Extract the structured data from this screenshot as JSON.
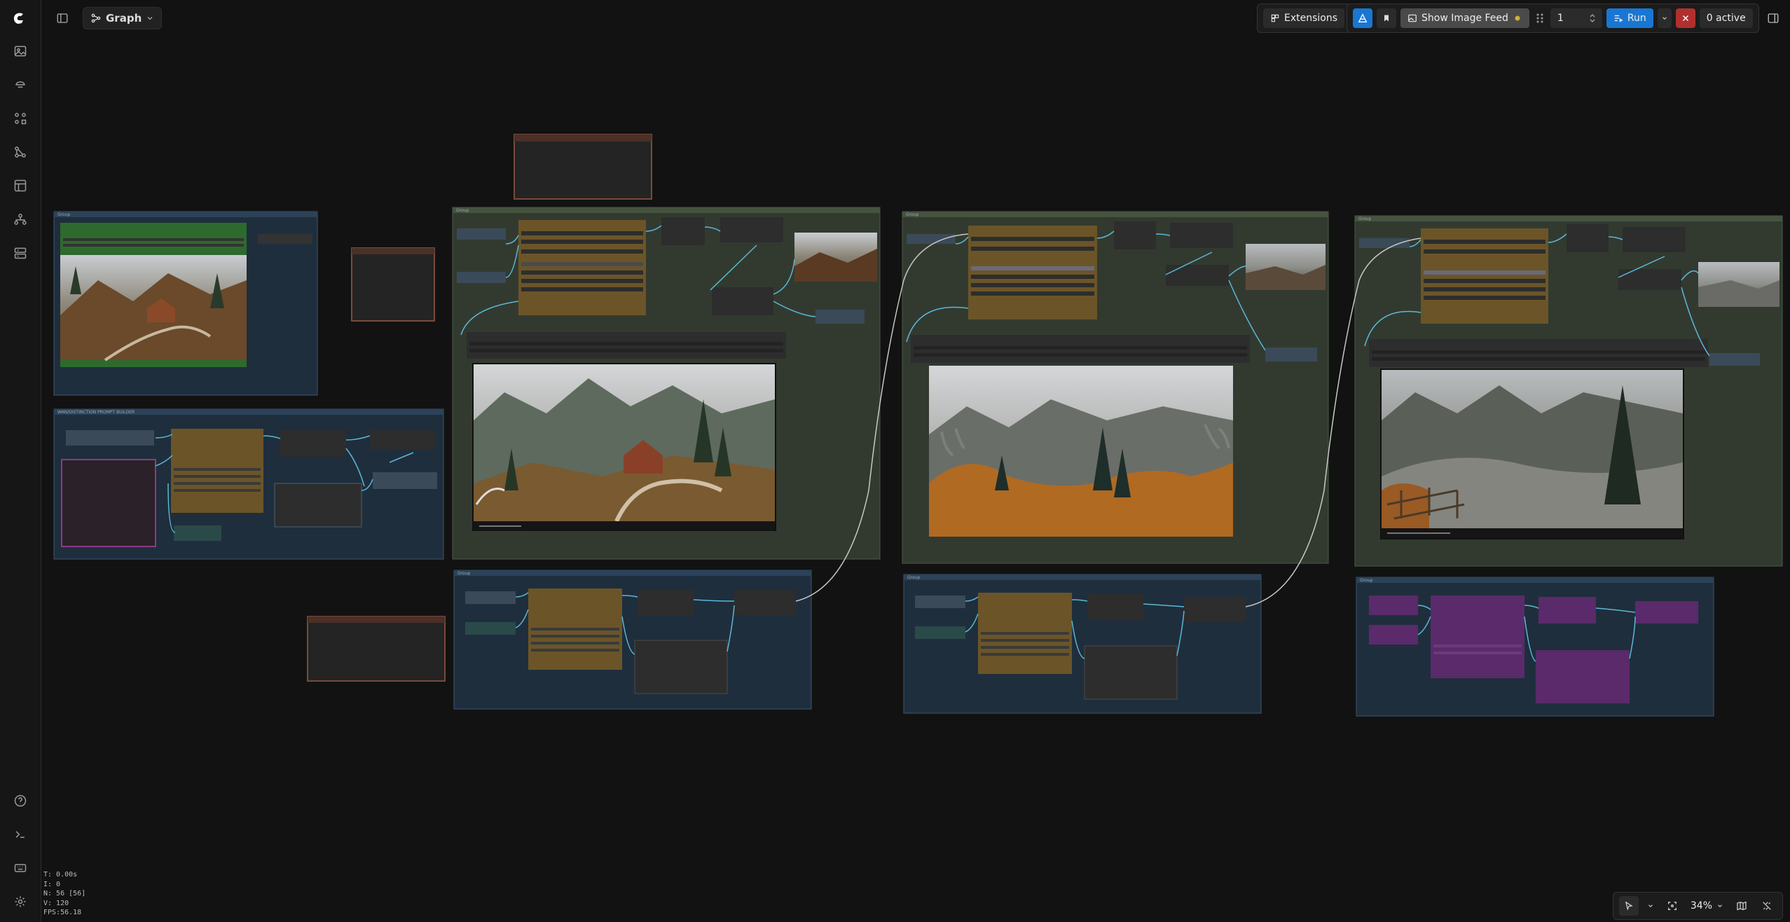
{
  "header": {
    "graph_tab_label": "Graph",
    "extensions_label": "Extensions",
    "show_image_feed_label": "Show Image Feed",
    "queue_count": "1",
    "run_label": "Run",
    "active_label": "0 active"
  },
  "stats": {
    "t": "T: 0.00s",
    "i": "I: 0",
    "n": "N: 56 [56]",
    "v": "V: 120",
    "fps": "FPS:56.18"
  },
  "zoom": {
    "level": "34%"
  },
  "groups": {
    "g1": "Group",
    "g2": "WAN/DISTINCTION PROMPT BUILDER",
    "g3": "Group",
    "g4": "Group",
    "g5": "Group",
    "g6": "Group",
    "g7": "Group",
    "g8": "Group"
  },
  "colors": {
    "accent": "#1976d2",
    "danger": "#b0302e",
    "group_blue": "#1f2e3c",
    "group_green": "#323a30",
    "node_gold": "#6b5528",
    "node_purple": "#5a2a6a"
  },
  "icons": {
    "logo": "comfy-logo",
    "sidebar": [
      "images-icon",
      "models-icon",
      "nodes-icon",
      "workflows-icon",
      "templates-icon",
      "network-icon",
      "layout-icon"
    ],
    "sidebar_bottom": [
      "help-icon",
      "terminal-icon",
      "keyboard-icon",
      "settings-icon"
    ]
  }
}
